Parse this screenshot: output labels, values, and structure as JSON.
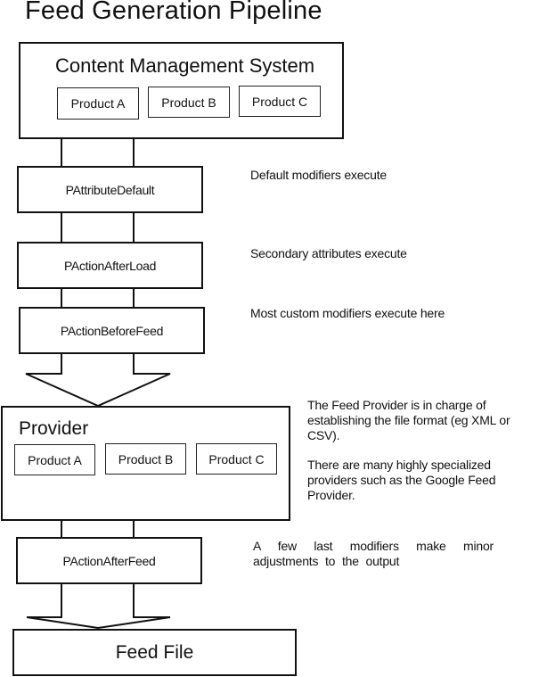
{
  "title": "Feed Generation Pipeline",
  "cms": {
    "title": "Content Management System",
    "products": [
      "Product A",
      "Product B",
      "Product C"
    ]
  },
  "stages": [
    {
      "name": "PAttributeDefault",
      "note": "Default modifiers execute"
    },
    {
      "name": "PActionAfterLoad",
      "note": "Secondary attributes execute"
    },
    {
      "name": "PActionBeforeFeed",
      "note": "Most custom modifiers execute here"
    }
  ],
  "provider": {
    "title": "Provider",
    "products": [
      "Product A",
      "Product B",
      "Product C"
    ],
    "note_1": "The Feed Provider is in charge of establishing the file format (eg XML or CSV).",
    "note_2": "There are many highly specialized providers such as the Google Feed Provider."
  },
  "after_feed": {
    "name": "PActionAfterFeed",
    "note": "A few last modifiers make minor adjustments to the output"
  },
  "output": {
    "title": "Feed File"
  },
  "colors": {
    "stroke": "#111111",
    "background": "#ffffff"
  }
}
